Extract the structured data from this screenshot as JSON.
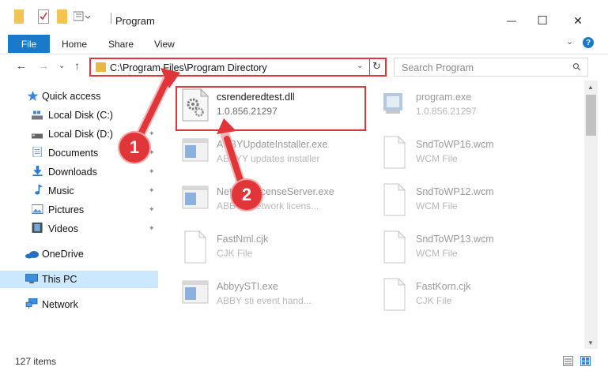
{
  "window": {
    "title": "Program",
    "controls": {
      "minimize": "—",
      "maximize": "☐",
      "close": "✕"
    }
  },
  "ribbon": {
    "tabs": [
      "File",
      "Home",
      "Share",
      "View"
    ],
    "help": "?",
    "expand": "⌄"
  },
  "navigation": {
    "back": "←",
    "forward": "→",
    "recent": "⌄",
    "up": "↑",
    "address": "C:\\Program Files\\Program Directory",
    "address_dropdown": "⌄",
    "refresh": "↻",
    "search_placeholder": "Search Program",
    "search_icon": "⚲"
  },
  "sidebar": {
    "items": [
      {
        "label": "Quick access",
        "icon": "star-icon",
        "pinned": false
      },
      {
        "label": "Local Disk (C:)",
        "icon": "drive-icon",
        "pinned": true
      },
      {
        "label": "Local Disk (D:)",
        "icon": "drive-icon",
        "pinned": true
      },
      {
        "label": "Documents",
        "icon": "documents-icon",
        "pinned": true
      },
      {
        "label": "Downloads",
        "icon": "downloads-icon",
        "pinned": true
      },
      {
        "label": "Music",
        "icon": "music-icon",
        "pinned": true
      },
      {
        "label": "Pictures",
        "icon": "pictures-icon",
        "pinned": true
      },
      {
        "label": "Videos",
        "icon": "videos-icon",
        "pinned": true
      },
      {
        "label": "OneDrive",
        "icon": "cloud-icon",
        "pinned": false
      },
      {
        "label": "This PC",
        "icon": "computer-icon",
        "pinned": false,
        "selected": true
      },
      {
        "label": "Network",
        "icon": "network-icon",
        "pinned": false
      }
    ],
    "pin_glyph": "📌"
  },
  "files": [
    {
      "name": "csrenderedtest.dll",
      "sub": "1.0.856.21297",
      "icon": "dll-gear-icon",
      "highlighted": true
    },
    {
      "name": "program.exe",
      "sub": "1.0.856.21297",
      "icon": "exe-icon"
    },
    {
      "name": "ABBYUpdateInstaller.exe",
      "sub": "ABBYY updates installer",
      "icon": "window-app-icon"
    },
    {
      "name": "SndToWP16.wcm",
      "sub": "WCM File",
      "icon": "blank-file-icon"
    },
    {
      "name": "NetworkLicenseServer.exe",
      "sub": "ABBYY network licens...",
      "icon": "window-app-icon"
    },
    {
      "name": "SndToWP12.wcm",
      "sub": "WCM File",
      "icon": "blank-file-icon"
    },
    {
      "name": "FastNml.cjk",
      "sub": "CJK File",
      "icon": "blank-file-icon"
    },
    {
      "name": "SndToWP13.wcm",
      "sub": "WCM File",
      "icon": "blank-file-icon"
    },
    {
      "name": "AbbyySTI.exe",
      "sub": "ABBY sti event hand...",
      "icon": "window-app-icon"
    },
    {
      "name": "FastKorn.cjk",
      "sub": "CJK File",
      "icon": "blank-file-icon"
    }
  ],
  "status": {
    "count": "127 items"
  },
  "annotations": {
    "step1": "1",
    "step2": "2"
  },
  "colors": {
    "accent": "#1979ca",
    "annotation_red": "#e0363a",
    "selection": "#cce8ff"
  }
}
